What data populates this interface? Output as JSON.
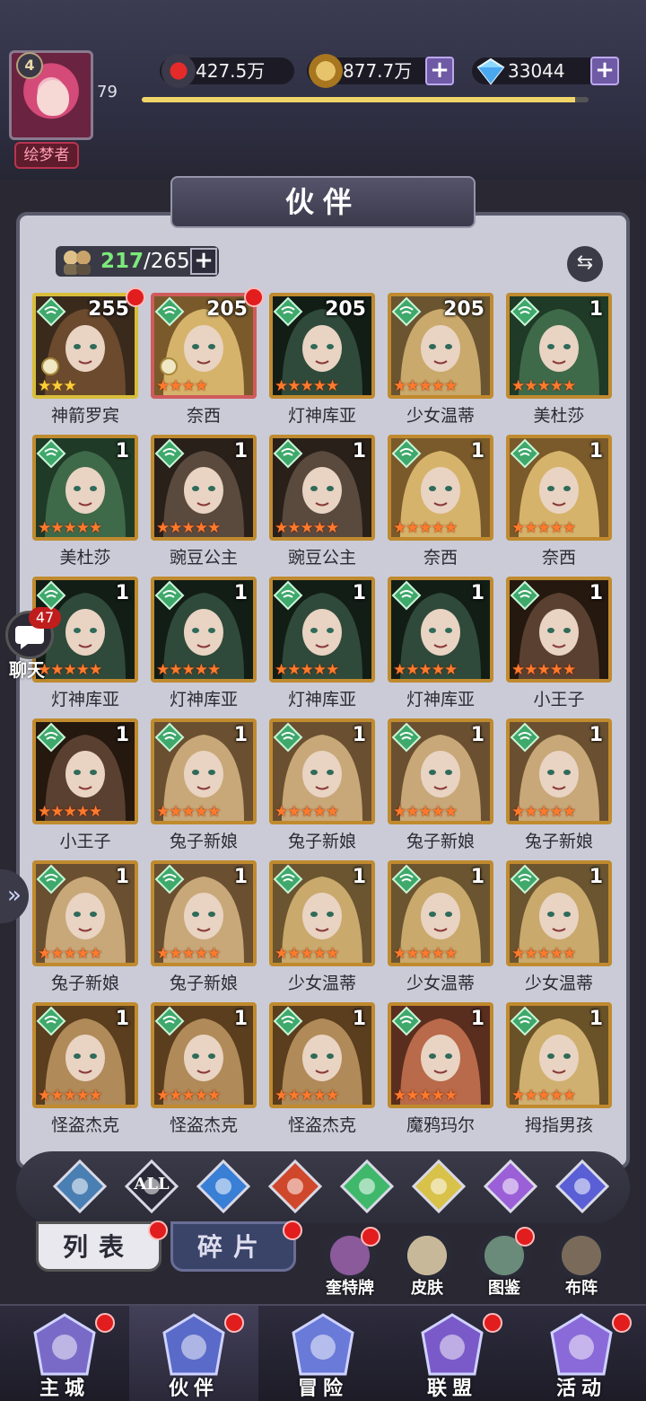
{
  "player": {
    "level": "4",
    "power": "79",
    "title": "绘梦者"
  },
  "resources": {
    "stamina": "427.5万",
    "gold": "877.7万",
    "diamonds": "33044",
    "plus": "+"
  },
  "xp_progress": 0.97,
  "panel": {
    "title": "伙伴",
    "count_current": "217",
    "count_sep": "/",
    "count_max": "265",
    "plus": "+",
    "swap_icon": "⇆"
  },
  "heroes": [
    {
      "name": "神箭罗宾",
      "level": "255",
      "stars": 3,
      "star_color": "gold",
      "frame": "gold",
      "red_dot": true,
      "medal": true
    },
    {
      "name": "奈西",
      "level": "205",
      "stars": 4,
      "star_color": "red",
      "frame": "red",
      "red_dot": true,
      "medal": true
    },
    {
      "name": "灯神库亚",
      "level": "205",
      "stars": 5,
      "star_color": "red",
      "frame": "orange",
      "red_dot": false,
      "medal": false
    },
    {
      "name": "少女温蒂",
      "level": "205",
      "stars": 5,
      "star_color": "red",
      "frame": "orange",
      "red_dot": false,
      "medal": false
    },
    {
      "name": "美杜莎",
      "level": "1",
      "stars": 5,
      "star_color": "red",
      "frame": "orange",
      "red_dot": false,
      "medal": false
    },
    {
      "name": "美杜莎",
      "level": "1",
      "stars": 5,
      "star_color": "red",
      "frame": "orange",
      "red_dot": false,
      "medal": false
    },
    {
      "name": "豌豆公主",
      "level": "1",
      "stars": 5,
      "star_color": "red",
      "frame": "orange",
      "red_dot": false,
      "medal": false
    },
    {
      "name": "豌豆公主",
      "level": "1",
      "stars": 5,
      "star_color": "red",
      "frame": "orange",
      "red_dot": false,
      "medal": false
    },
    {
      "name": "奈西",
      "level": "1",
      "stars": 5,
      "star_color": "red",
      "frame": "orange",
      "red_dot": false,
      "medal": false
    },
    {
      "name": "奈西",
      "level": "1",
      "stars": 5,
      "star_color": "red",
      "frame": "orange",
      "red_dot": false,
      "medal": false
    },
    {
      "name": "灯神库亚",
      "level": "1",
      "stars": 5,
      "star_color": "red",
      "frame": "orange",
      "red_dot": false,
      "medal": false
    },
    {
      "name": "灯神库亚",
      "level": "1",
      "stars": 5,
      "star_color": "red",
      "frame": "orange",
      "red_dot": false,
      "medal": false
    },
    {
      "name": "灯神库亚",
      "level": "1",
      "stars": 5,
      "star_color": "red",
      "frame": "orange",
      "red_dot": false,
      "medal": false
    },
    {
      "name": "灯神库亚",
      "level": "1",
      "stars": 5,
      "star_color": "red",
      "frame": "orange",
      "red_dot": false,
      "medal": false
    },
    {
      "name": "小王子",
      "level": "1",
      "stars": 5,
      "star_color": "red",
      "frame": "orange",
      "red_dot": false,
      "medal": false
    },
    {
      "name": "小王子",
      "level": "1",
      "stars": 5,
      "star_color": "red",
      "frame": "orange",
      "red_dot": false,
      "medal": false
    },
    {
      "name": "兔子新娘",
      "level": "1",
      "stars": 5,
      "star_color": "red",
      "frame": "orange",
      "red_dot": false,
      "medal": false
    },
    {
      "name": "兔子新娘",
      "level": "1",
      "stars": 5,
      "star_color": "red",
      "frame": "orange",
      "red_dot": false,
      "medal": false
    },
    {
      "name": "兔子新娘",
      "level": "1",
      "stars": 5,
      "star_color": "red",
      "frame": "orange",
      "red_dot": false,
      "medal": false
    },
    {
      "name": "兔子新娘",
      "level": "1",
      "stars": 5,
      "star_color": "red",
      "frame": "orange",
      "red_dot": false,
      "medal": false
    },
    {
      "name": "兔子新娘",
      "level": "1",
      "stars": 5,
      "star_color": "red",
      "frame": "orange",
      "red_dot": false,
      "medal": false
    },
    {
      "name": "兔子新娘",
      "level": "1",
      "stars": 5,
      "star_color": "red",
      "frame": "orange",
      "red_dot": false,
      "medal": false
    },
    {
      "name": "少女温蒂",
      "level": "1",
      "stars": 5,
      "star_color": "red",
      "frame": "orange",
      "red_dot": false,
      "medal": false
    },
    {
      "name": "少女温蒂",
      "level": "1",
      "stars": 5,
      "star_color": "red",
      "frame": "orange",
      "red_dot": false,
      "medal": false
    },
    {
      "name": "少女温蒂",
      "level": "1",
      "stars": 5,
      "star_color": "red",
      "frame": "orange",
      "red_dot": false,
      "medal": false
    },
    {
      "name": "怪盗杰克",
      "level": "1",
      "stars": 5,
      "star_color": "red",
      "frame": "orange",
      "red_dot": false,
      "medal": false
    },
    {
      "name": "怪盗杰克",
      "level": "1",
      "stars": 5,
      "star_color": "red",
      "frame": "orange",
      "red_dot": false,
      "medal": false
    },
    {
      "name": "怪盗杰克",
      "level": "1",
      "stars": 5,
      "star_color": "red",
      "frame": "orange",
      "red_dot": false,
      "medal": false
    },
    {
      "name": "魔鸦玛尔",
      "level": "1",
      "stars": 5,
      "star_color": "red",
      "frame": "orange",
      "red_dot": false,
      "medal": false
    },
    {
      "name": "拇指男孩",
      "level": "1",
      "stars": 5,
      "star_color": "red",
      "frame": "orange",
      "red_dot": false,
      "medal": false
    }
  ],
  "filters": [
    {
      "name": "shield-element",
      "color": "#4a7fb3",
      "label": ""
    },
    {
      "name": "all",
      "color": "#2a2a38",
      "label": "ALL"
    },
    {
      "name": "water-element",
      "color": "#3a7fd6",
      "label": ""
    },
    {
      "name": "fire-element",
      "color": "#d0482c",
      "label": ""
    },
    {
      "name": "wind-element",
      "color": "#3fb86b",
      "label": ""
    },
    {
      "name": "light-element",
      "color": "#d9c24a",
      "label": ""
    },
    {
      "name": "moon-element",
      "color": "#9b5fd8",
      "label": ""
    },
    {
      "name": "planet-element",
      "color": "#5a5fd6",
      "label": ""
    }
  ],
  "tabs": {
    "list": "列表",
    "fragments": "碎片"
  },
  "side_buttons": [
    {
      "label": "奎特牌",
      "red_dot": true
    },
    {
      "label": "皮肤",
      "red_dot": false
    },
    {
      "label": "图鉴",
      "red_dot": true
    },
    {
      "label": "布阵",
      "red_dot": false
    }
  ],
  "chat": {
    "label": "聊天",
    "badge": "47"
  },
  "side_arrow": "»",
  "nav": [
    {
      "label": "主城",
      "active": false,
      "red_dot": true
    },
    {
      "label": "伙伴",
      "active": true,
      "red_dot": true
    },
    {
      "label": "冒险",
      "active": false,
      "red_dot": false
    },
    {
      "label": "联盟",
      "active": false,
      "red_dot": true
    },
    {
      "label": "活动",
      "active": false,
      "red_dot": true
    }
  ]
}
